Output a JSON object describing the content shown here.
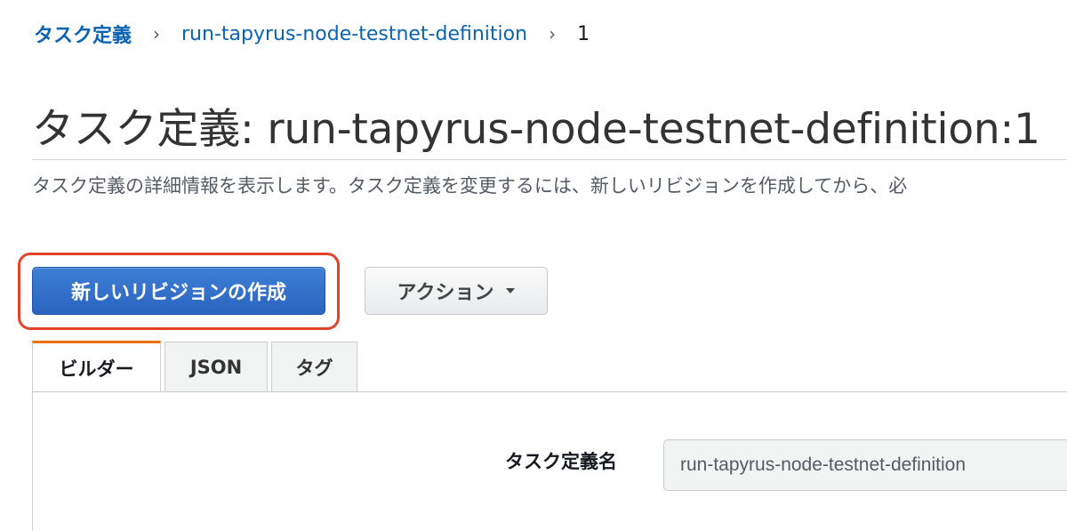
{
  "breadcrumb": {
    "root": "タスク定義",
    "parent": "run-tapyrus-node-testnet-definition",
    "current": "1",
    "separator": "›"
  },
  "header": {
    "title": "タスク定義: run-tapyrus-node-testnet-definition:1",
    "description": "タスク定義の詳細情報を表示します。タスク定義を変更するには、新しいリビジョンを作成してから、必"
  },
  "actions": {
    "create_revision_label": "新しいリビジョンの作成",
    "actions_label": "アクション"
  },
  "tabs": [
    {
      "label": "ビルダー",
      "active": true
    },
    {
      "label": "JSON",
      "active": false
    },
    {
      "label": "タグ",
      "active": false
    }
  ],
  "form": {
    "task_definition_name_label": "タスク定義名",
    "task_definition_name_value": "run-tapyrus-node-testnet-definition"
  },
  "colors": {
    "link": "#0a63b3",
    "primary_button": "#2a64c0",
    "active_tab_accent": "#ec7211",
    "highlight_ring": "#e0442a"
  }
}
